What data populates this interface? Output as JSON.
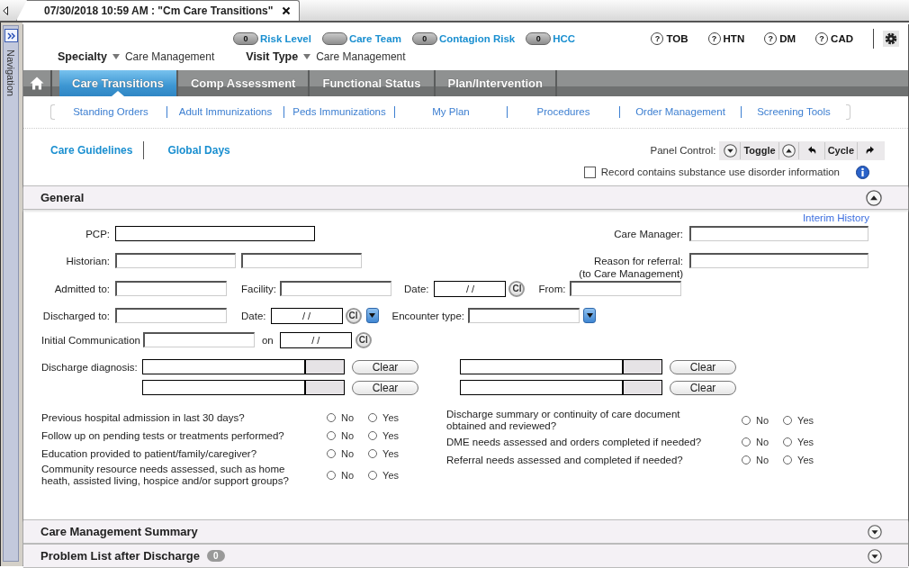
{
  "document_tab": {
    "title": "07/30/2018 10:59 AM : \"Cm Care Transitions\""
  },
  "navigation": {
    "label": "Navigation"
  },
  "indicators": [
    {
      "count": "0",
      "label": "Risk Level"
    },
    {
      "label": "Care Team"
    },
    {
      "count": "0",
      "label": "Contagion Risk"
    },
    {
      "count": "0",
      "label": "HCC"
    }
  ],
  "help_topics": [
    {
      "icon": "?",
      "label": "TOB"
    },
    {
      "icon": "?",
      "label": "HTN"
    },
    {
      "icon": "?",
      "label": "DM"
    },
    {
      "icon": "?",
      "label": "CAD"
    }
  ],
  "context": [
    {
      "label": "Specialty",
      "value": "Care Management"
    },
    {
      "label": "Visit Type",
      "value": "Care Management"
    }
  ],
  "tabs": [
    {
      "label": "Care Transitions",
      "selected": true
    },
    {
      "label": "Comp Assessment",
      "selected": false
    },
    {
      "label": "Functional Status",
      "selected": false
    },
    {
      "label": "Plan/Intervention",
      "selected": false
    }
  ],
  "subtabs": [
    "Standing Orders",
    "Adult Immunizations",
    "Peds Immunizations",
    "My Plan",
    "Procedures",
    "Order Management",
    "Screening Tools"
  ],
  "links": [
    "Care Guidelines",
    "Global Days"
  ],
  "panel_control": {
    "label": "Panel Control:",
    "buttons": [
      {
        "kind": "down"
      },
      {
        "kind": "text",
        "label": "Toggle"
      },
      {
        "kind": "up"
      },
      {
        "kind": "back"
      },
      {
        "kind": "text",
        "label": "Cycle"
      },
      {
        "kind": "forward"
      }
    ]
  },
  "substance_disorder": {
    "label": "Record contains substance use disorder information",
    "checked": false
  },
  "sections": [
    {
      "title": "General",
      "expanded": true
    },
    {
      "title": "Care Management Summary",
      "expanded": false
    },
    {
      "title": "Problem List after Discharge",
      "expanded": false,
      "count": "0"
    }
  ],
  "general": {
    "interim_history": "Interim History",
    "rows": [
      {
        "left": [
          {
            "kind": "label",
            "text": "PCP:"
          },
          {
            "kind": "field"
          }
        ],
        "right": [
          {
            "kind": "label",
            "text": "Care Manager:"
          },
          {
            "kind": "field"
          }
        ]
      },
      {
        "left": [
          {
            "kind": "label",
            "text": "Historian:"
          },
          {
            "kind": "field"
          },
          {
            "kind": "field"
          }
        ],
        "right": [
          {
            "kind": "label",
            "text": "Reason for referral:",
            "note": "(to Care Management)"
          },
          {
            "kind": "field"
          }
        ]
      },
      {
        "left": [
          {
            "kind": "label",
            "text": "Admitted to:"
          },
          {
            "kind": "field"
          },
          {
            "kind": "label",
            "text": "Facility:"
          },
          {
            "kind": "field"
          },
          {
            "kind": "label",
            "text": "Date:"
          },
          {
            "kind": "date",
            "value": "/ /"
          },
          {
            "kind": "clear",
            "label": "Cl"
          },
          {
            "kind": "label",
            "text": "From:"
          },
          {
            "kind": "field"
          }
        ]
      },
      {
        "left": [
          {
            "kind": "label",
            "text": "Discharged to:"
          },
          {
            "kind": "field"
          },
          {
            "kind": "label",
            "text": "Date:"
          },
          {
            "kind": "date",
            "value": "/ /"
          },
          {
            "kind": "clear",
            "label": "Cl"
          },
          {
            "kind": "dropdown"
          },
          {
            "kind": "label",
            "text": "Encounter type:"
          },
          {
            "kind": "field"
          },
          {
            "kind": "dropdown"
          }
        ]
      },
      {
        "left": [
          {
            "kind": "label",
            "text": "Initial Communication"
          },
          {
            "kind": "field"
          },
          {
            "kind": "label",
            "text": "on"
          },
          {
            "kind": "date",
            "value": "/ /"
          },
          {
            "kind": "clear",
            "label": "Cl"
          }
        ]
      }
    ],
    "diagnosis": {
      "label": "Discharge diagnosis:",
      "entries": [
        {
          "button": "Clear"
        },
        {
          "button": "Clear"
        },
        {
          "button": "Clear"
        },
        {
          "button": "Clear"
        }
      ]
    },
    "questions_left": [
      {
        "text": "Previous hospital admission in last 30 days?",
        "options": [
          {
            "label": "No",
            "selected": false
          },
          {
            "label": "Yes",
            "selected": false
          }
        ]
      },
      {
        "text": "Follow up on pending tests or treatments performed?",
        "options": [
          {
            "label": "No",
            "selected": false
          },
          {
            "label": "Yes",
            "selected": false
          }
        ]
      },
      {
        "text": "Education provided to patient/family/caregiver?",
        "options": [
          {
            "label": "No",
            "selected": false
          },
          {
            "label": "Yes",
            "selected": false
          }
        ]
      },
      {
        "text": "Community resource needs assessed, such as home heath, assisted living, hospice and/or support groups?",
        "options": [
          {
            "label": "No",
            "selected": false
          },
          {
            "label": "Yes",
            "selected": false
          }
        ]
      }
    ],
    "questions_right": [
      {
        "text": "Discharge summary or continuity of care document obtained and reviewed?",
        "options": [
          {
            "label": "No",
            "selected": false
          },
          {
            "label": "Yes",
            "selected": false
          }
        ]
      },
      {
        "text": "DME needs assessed and orders completed if needed?",
        "options": [
          {
            "label": "No",
            "selected": false
          },
          {
            "label": "Yes",
            "selected": false
          }
        ]
      },
      {
        "text": "Referral needs assessed and completed if needed?",
        "options": [
          {
            "label": "No",
            "selected": false
          },
          {
            "label": "Yes",
            "selected": false
          }
        ]
      }
    ]
  }
}
